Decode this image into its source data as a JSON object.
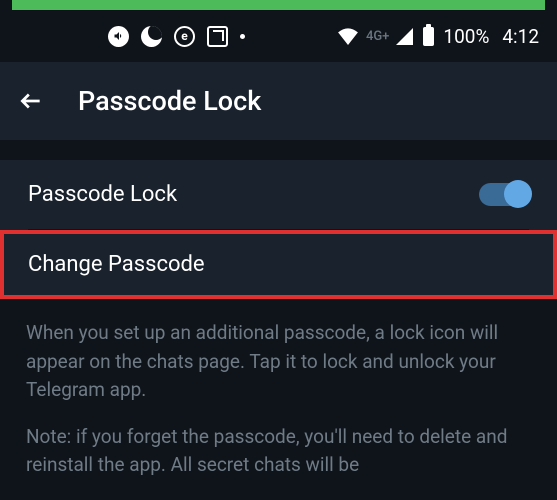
{
  "statusBar": {
    "networkLabel": "4G+",
    "batteryPct": "100%",
    "time": "4:12"
  },
  "appBar": {
    "title": "Passcode Lock"
  },
  "settings": {
    "passcodeLock": {
      "label": "Passcode Lock",
      "enabled": true
    },
    "changePasscode": {
      "label": "Change Passcode"
    }
  },
  "helpText": {
    "p1": "When you set up an additional passcode, a lock icon will appear on the chats page. Tap it to lock and unlock your Telegram app.",
    "p2": "Note: if you forget the passcode, you'll need to delete and reinstall the app. All secret chats will be"
  }
}
